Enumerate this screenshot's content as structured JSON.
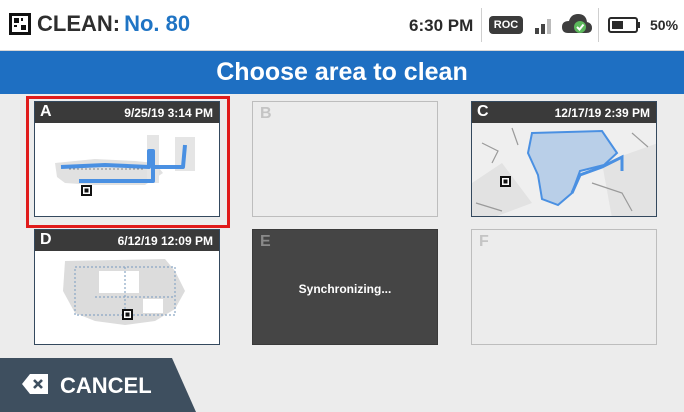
{
  "status_bar": {
    "title_prefix": "CLEAN:",
    "robot_number": "No. 80",
    "time": "6:30 PM",
    "roc_label": "ROC",
    "battery_percent": "50%",
    "battery_level": 0.5,
    "icons": [
      "robot-qr-icon",
      "signal-icon",
      "cloud-check-icon",
      "battery-icon"
    ]
  },
  "header": {
    "title": "Choose area to clean"
  },
  "tiles": [
    {
      "letter": "A",
      "date": "9/25/19 3:14 PM",
      "state": "map",
      "selected": true
    },
    {
      "letter": "B",
      "date": "",
      "state": "empty",
      "selected": false
    },
    {
      "letter": "C",
      "date": "12/17/19 2:39 PM",
      "state": "map",
      "selected": false
    },
    {
      "letter": "D",
      "date": "6/12/19 12:09 PM",
      "state": "map",
      "selected": false
    },
    {
      "letter": "E",
      "date": "",
      "state": "synchronizing",
      "status_text": "Synchronizing...",
      "selected": false
    },
    {
      "letter": "F",
      "date": "",
      "state": "empty",
      "selected": false
    }
  ],
  "cancel_button": {
    "label": "CANCEL",
    "icon": "backspace-x-icon"
  },
  "colors": {
    "accent_blue": "#1e6fc2",
    "selection_red": "#e01b1b",
    "dark": "#3a3a3a",
    "path_blue": "#4a90e2"
  }
}
